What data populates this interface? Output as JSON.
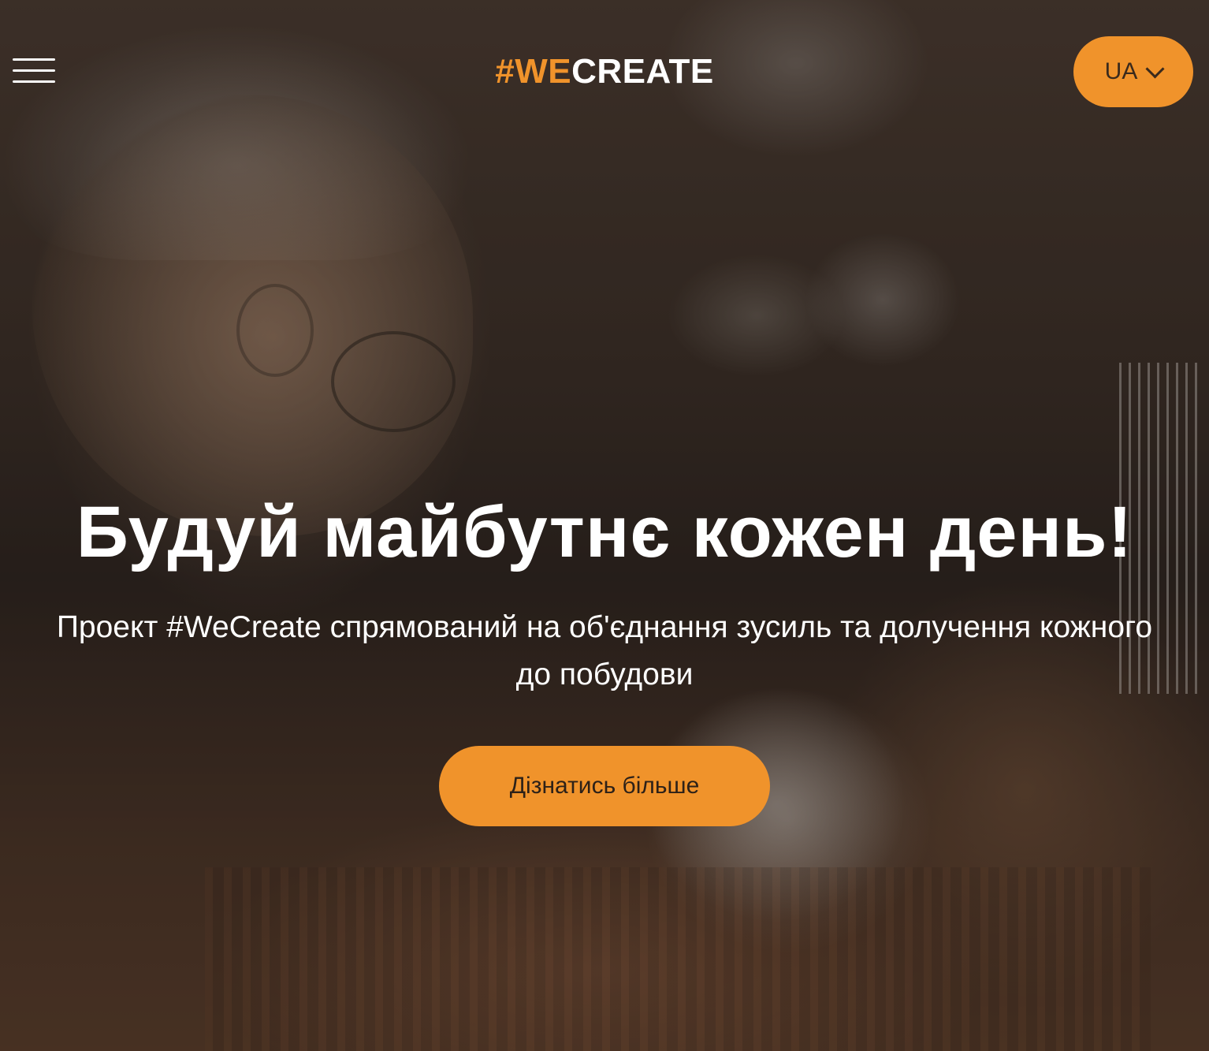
{
  "header": {
    "logo_hash": "#",
    "logo_we": "WE",
    "logo_create": "CREATE",
    "language": "UA"
  },
  "hero": {
    "title": "Будуй майбутнє кожен день!",
    "subtitle": "Проект #WeCreate спрямований на об'єднання зусиль та долучення кожного до побудови",
    "cta_label": "Дізнатись більше"
  },
  "colors": {
    "accent": "#f0932b",
    "text": "#ffffff",
    "button_text": "#2d2118"
  },
  "icons": {
    "menu": "hamburger-icon",
    "language_toggle": "chevron-down-icon"
  }
}
